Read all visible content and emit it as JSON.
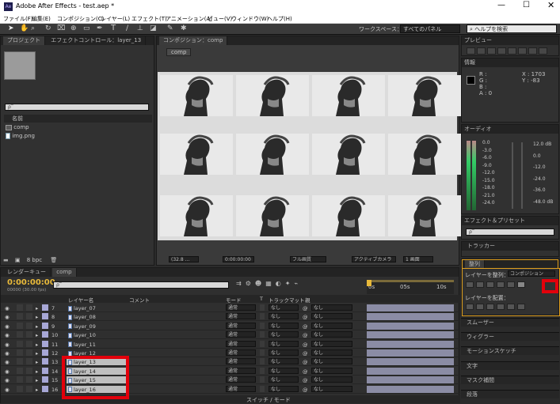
{
  "window": {
    "title": "Adobe After Effects - test.aep *",
    "app_icon": "Ae"
  },
  "menu": [
    "ファイル(F)",
    "編集(E)",
    "コンポジション(C)",
    "レイヤー(L)",
    "エフェクト(T)",
    "アニメーション(A)",
    "ビュー(V)",
    "ウィンドウ(W)",
    "ヘルプ(H)"
  ],
  "toolbar": {
    "workspace_label": "ワークスペース：",
    "workspace_value": "すべてのパネル",
    "help_search": "ヘルプを検索"
  },
  "project": {
    "tab": "プロジェクト",
    "effect_tab": "エフェクトコントロール：layer_13",
    "search": "ρ‾",
    "col_name": "名前",
    "items": [
      "comp",
      "img.png"
    ],
    "bpc": "8 bpc"
  },
  "comp_panel": {
    "tab": "コンポジション：comp",
    "breadcrumb": "comp",
    "zoom": "(32.8 ...",
    "time": "0:00:00:00",
    "quality": "フル画質",
    "camera": "アクティブカメラ",
    "views": "1 画面"
  },
  "preview": {
    "title": "プレビュー"
  },
  "info": {
    "title": "情報",
    "r": "R :",
    "g": "G :",
    "b": "B :",
    "a": "A : 0",
    "x": "X : 1703",
    "y": "Y : -83"
  },
  "audio": {
    "title": "オーディオ",
    "left_scale": [
      "0.0",
      "-3.0",
      "-6.0",
      "-9.0",
      "-12.0",
      "-15.0",
      "-18.0",
      "-21.0",
      "-24.0"
    ],
    "right_scale": [
      "12.0 dB",
      "0.0",
      "-12.0",
      "-24.0",
      "-36.0",
      "-48.0 dB"
    ]
  },
  "effects": {
    "title": "エフェクト＆プリセット",
    "search": "ρ‾"
  },
  "tracker": {
    "title": "トラッカー"
  },
  "align": {
    "title": "整列",
    "align_to_label": "レイヤーを整列：",
    "align_to_value": "コンポジション",
    "distribute_label": "レイヤーを配置："
  },
  "panels_below": [
    "スムーザー",
    "ウィグラー",
    "モーションスケッチ",
    "文字",
    "マスク補間",
    "段落"
  ],
  "timeline": {
    "render_tab": "レンダーキュー",
    "comp_tab": "comp",
    "time": "0:00:00:00",
    "fps": "00000 (30.00 fps)",
    "search": "ρ‾",
    "headers": {
      "layer_name": "レイヤー名",
      "comment": "コメント",
      "mode": "モード",
      "t": "T",
      "trkmat": "トラックマット",
      "parent": "親"
    },
    "ruler": [
      "0s",
      "05s",
      "10s"
    ],
    "footer": "スイッチ / モード",
    "layers": [
      {
        "num": "7",
        "name": "layer_07",
        "mode": "通常",
        "trk": "なし",
        "parent": "なし"
      },
      {
        "num": "8",
        "name": "layer_08",
        "mode": "通常",
        "trk": "なし",
        "parent": "なし"
      },
      {
        "num": "9",
        "name": "layer_09",
        "mode": "通常",
        "trk": "なし",
        "parent": "なし"
      },
      {
        "num": "10",
        "name": "layer_10",
        "mode": "通常",
        "trk": "なし",
        "parent": "なし"
      },
      {
        "num": "11",
        "name": "layer_11",
        "mode": "通常",
        "trk": "なし",
        "parent": "なし"
      },
      {
        "num": "12",
        "name": "layer_12",
        "mode": "通常",
        "trk": "なし",
        "parent": "なし"
      },
      {
        "num": "13",
        "name": "layer_13",
        "mode": "通常",
        "trk": "なし",
        "parent": "なし"
      },
      {
        "num": "14",
        "name": "layer_14",
        "mode": "通常",
        "trk": "なし",
        "parent": "なし"
      },
      {
        "num": "15",
        "name": "layer_15",
        "mode": "通常",
        "trk": "なし",
        "parent": "なし"
      },
      {
        "num": "16",
        "name": "layer_16",
        "mode": "通常",
        "trk": "なし",
        "parent": "なし"
      }
    ]
  }
}
